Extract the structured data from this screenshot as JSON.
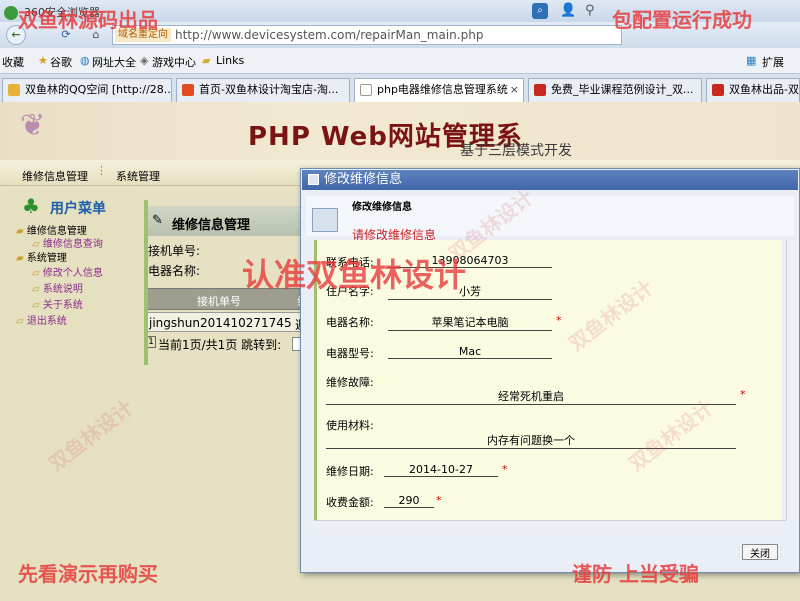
{
  "browser": {
    "window_title": "360安全浏览器",
    "redirect_label": "域名重定向",
    "url": "http://www.devicesystem.com/repairMan_main.php",
    "extensions_label": "扩展",
    "fav_label": "收藏",
    "bookmarks": [
      "谷歌",
      "网址大全",
      "游戏中心",
      "Links"
    ],
    "tabs": [
      {
        "label": "双鱼林的QQ空间 [http://28...",
        "active": false
      },
      {
        "label": "首页-双鱼林设计淘宝店-淘...",
        "active": false
      },
      {
        "label": "php电器维修信息管理系统",
        "active": true
      },
      {
        "label": "免费_毕业课程范例设计_双...",
        "active": false
      },
      {
        "label": "双鱼林出品-双鱼",
        "active": false
      }
    ]
  },
  "page": {
    "banner_title": "PHP Web网站管理系",
    "banner_subtitle": "基于三层模式开发",
    "top_menu": [
      "维修信息管理",
      "系统管理"
    ],
    "user_menu_title": "用户菜单",
    "tree": [
      {
        "label": "维修信息管理",
        "level": 0
      },
      {
        "label": "维修信息查询",
        "level": 1
      },
      {
        "label": "系统管理",
        "level": 0
      },
      {
        "label": "修改个人信息",
        "level": 1
      },
      {
        "label": "系统说明",
        "level": 1
      },
      {
        "label": "关于系统",
        "level": 1
      },
      {
        "label": "退出系统",
        "level": 0
      }
    ],
    "content_title": "维修信息管理",
    "search_labels": [
      "接机单号:",
      "电器名称:"
    ],
    "table_header": [
      "接机单号",
      "维"
    ],
    "table_cell": "jingshun201410271745",
    "table_cell2": "週",
    "pager": "当前1页/共1页 跳转到:",
    "pager_num": "1"
  },
  "dialog": {
    "title": "修改维修信息",
    "header_label": "修改维修信息",
    "hint": "请修改维修信息",
    "fields": {
      "phone": {
        "label": "联系电话:",
        "value": "13908064703"
      },
      "owner": {
        "label": "住户名字:",
        "value": "小芳"
      },
      "device_name": {
        "label": "电器名称:",
        "value": "苹果笔记本电脑"
      },
      "model": {
        "label": "电器型号:",
        "value": "Mac"
      },
      "fault": {
        "label": "维修故障:",
        "value": "经常死机重启"
      },
      "material": {
        "label": "使用材料:",
        "value": "内存有问题换一个"
      },
      "date": {
        "label": "维修日期:",
        "value": "2014-10-27"
      },
      "fee": {
        "label": "收费金额:",
        "value": "290"
      }
    },
    "required_mark": "*",
    "close_label": "关闭"
  },
  "watermarks": {
    "top_left": "双鱼林源码出品",
    "top_right": "包配置运行成功",
    "center": "认准双鱼林设计",
    "bottom_left": "先看演示再购买",
    "bottom_right": "谨防 上当受骗",
    "diagonal": "双鱼林设计"
  },
  "colors": {
    "accent": "#3f66a8",
    "watermark": "#e63c3c",
    "required": "#cc0000"
  }
}
